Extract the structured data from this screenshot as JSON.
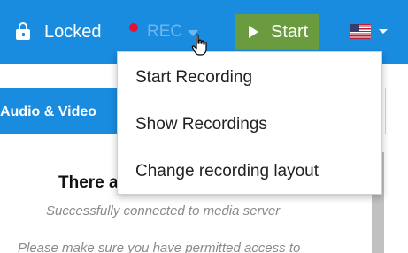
{
  "header": {
    "lock_label": "Locked",
    "rec_label": "REC",
    "start_label": "Start"
  },
  "tabs": {
    "active_label": "Audio & Video"
  },
  "panel": {
    "title": "There a",
    "subtitle": "Successfully connected to media server",
    "note": "Please make sure you have permitted access to"
  },
  "rec_menu": {
    "items": [
      {
        "label": "Start Recording"
      },
      {
        "label": "Show Recordings"
      },
      {
        "label": "Change recording layout"
      }
    ]
  },
  "colors": {
    "header_bg": "#1a8ce0",
    "rec_dot": "#e8112d",
    "start_button": "#6a9c3f"
  },
  "icons": {
    "lock": "lock-icon",
    "rec": "record-dot-icon",
    "play": "play-icon",
    "flag": "us-flag-icon",
    "cursor": "hand-cursor-icon"
  }
}
